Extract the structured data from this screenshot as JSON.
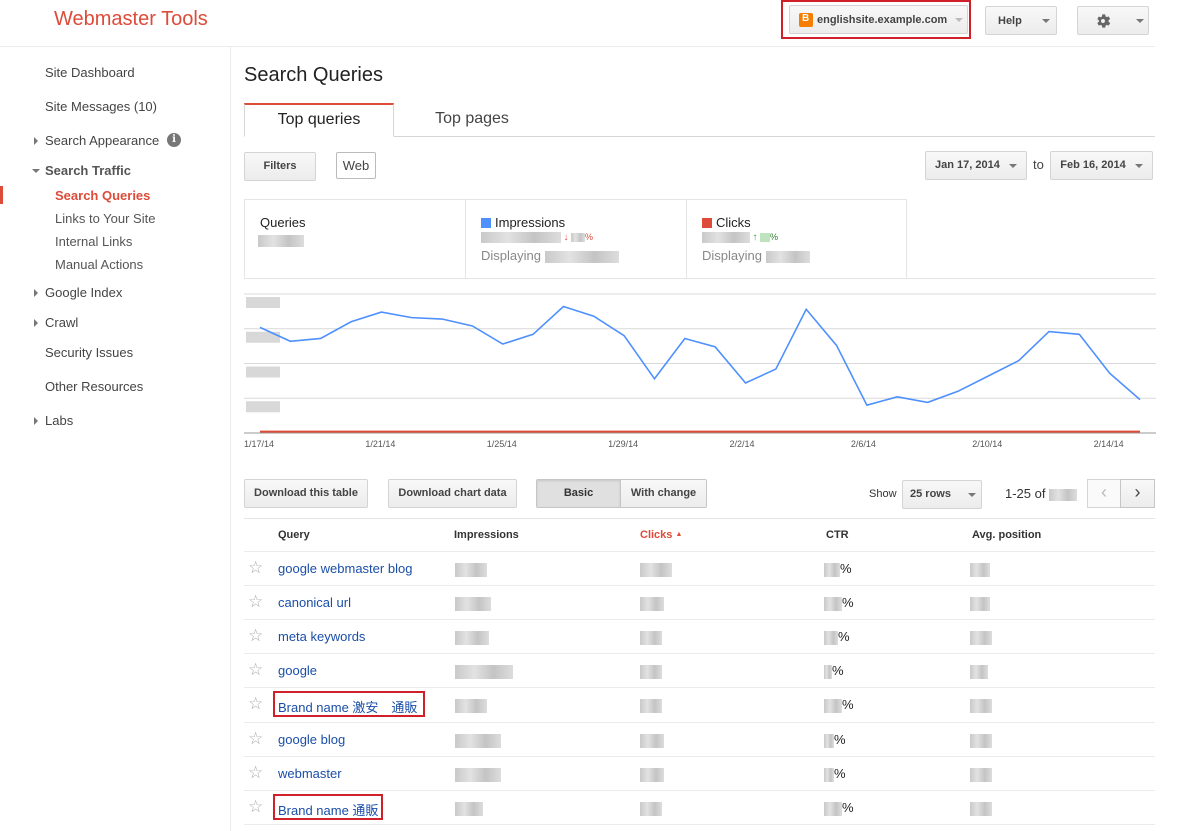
{
  "header": {
    "app_title": "Webmaster Tools",
    "site_selector": "englishsite.example.com",
    "help_label": "Help"
  },
  "sidebar": {
    "items": [
      {
        "label": "Site Dashboard"
      },
      {
        "label": "Site Messages (10)"
      },
      {
        "label": "Search Appearance"
      },
      {
        "label": "Search Traffic"
      },
      {
        "label": "Search Queries"
      },
      {
        "label": "Links to Your Site"
      },
      {
        "label": "Internal Links"
      },
      {
        "label": "Manual Actions"
      },
      {
        "label": "Google Index"
      },
      {
        "label": "Crawl"
      },
      {
        "label": "Security Issues"
      },
      {
        "label": "Other Resources"
      },
      {
        "label": "Labs"
      }
    ],
    "info_icon": "i"
  },
  "main": {
    "title": "Search Queries",
    "tabs": [
      {
        "label": "Top queries"
      },
      {
        "label": "Top pages"
      }
    ],
    "filters_label": "Filters",
    "web_chip": "Web",
    "date_from": "Jan 17, 2014",
    "date_to_sep": "to",
    "date_to": "Feb 16, 2014",
    "stats": {
      "queries_label": "Queries",
      "impressions_label": "Impressions",
      "impressions_change": "%",
      "impressions_sub": "Displaying",
      "clicks_label": "Clicks",
      "clicks_change": "%",
      "clicks_sub": "Displaying",
      "impressions_color": "#4d90fe",
      "clicks_color": "#dd4b39"
    },
    "toolbar": {
      "download_table": "Download this table",
      "download_chart": "Download chart data",
      "basic": "Basic",
      "with_change": "With change",
      "show": "Show",
      "rows": "25 rows",
      "range": "1-25 of"
    },
    "table": {
      "headers": {
        "query": "Query",
        "impressions": "Impressions",
        "clicks": "Clicks",
        "ctr": "CTR",
        "position": "Avg. position"
      },
      "sort_arrow": "▲",
      "rows": [
        {
          "query": "google webmaster blog",
          "ctr": "%"
        },
        {
          "query": "canonical url",
          "ctr": "%"
        },
        {
          "query": "meta keywords",
          "ctr": "%"
        },
        {
          "query": "google",
          "ctr": "%"
        },
        {
          "query": "Brand name 激安　通販",
          "ctr": "%"
        },
        {
          "query": "google blog",
          "ctr": "%"
        },
        {
          "query": "webmaster",
          "ctr": "%"
        },
        {
          "query": "Brand name 通販",
          "ctr": "%"
        }
      ]
    }
  },
  "chart_data": {
    "type": "line",
    "x": [
      "1/17/14",
      "1/18/14",
      "1/19/14",
      "1/20/14",
      "1/21/14",
      "1/22/14",
      "1/23/14",
      "1/24/14",
      "1/25/14",
      "1/26/14",
      "1/27/14",
      "1/28/14",
      "1/29/14",
      "1/30/14",
      "1/31/14",
      "2/1/14",
      "2/2/14",
      "2/3/14",
      "2/4/14",
      "2/5/14",
      "2/6/14",
      "2/7/14",
      "2/8/14",
      "2/9/14",
      "2/10/14",
      "2/11/14",
      "2/12/14",
      "2/13/14",
      "2/14/14",
      "2/15/14"
    ],
    "x_ticks": [
      "1/17/14",
      "1/21/14",
      "1/25/14",
      "1/29/14",
      "2/2/14",
      "2/6/14",
      "2/10/14",
      "2/14/14"
    ],
    "series": [
      {
        "name": "Impressions",
        "color": "#4d90fe",
        "values": [
          0.76,
          0.66,
          0.68,
          0.8,
          0.87,
          0.83,
          0.82,
          0.77,
          0.64,
          0.71,
          0.91,
          0.84,
          0.7,
          0.39,
          0.68,
          0.62,
          0.36,
          0.46,
          0.89,
          0.63,
          0.2,
          0.26,
          0.22,
          0.3,
          0.41,
          0.52,
          0.73,
          0.71,
          0.43,
          0.24
        ]
      },
      {
        "name": "Clicks",
        "color": "#dd4b39",
        "values": [
          0.01,
          0.01,
          0.01,
          0.01,
          0.01,
          0.01,
          0.01,
          0.01,
          0.01,
          0.01,
          0.01,
          0.01,
          0.01,
          0.01,
          0.01,
          0.01,
          0.01,
          0.01,
          0.01,
          0.01,
          0.01,
          0.01,
          0.01,
          0.01,
          0.01,
          0.01,
          0.01,
          0.01,
          0.01,
          0.01
        ]
      }
    ],
    "ylim": [
      0,
      1
    ],
    "grid": true
  }
}
